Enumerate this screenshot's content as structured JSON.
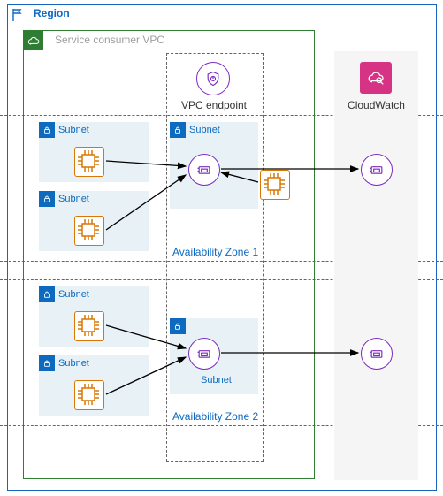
{
  "region": {
    "label": "Region"
  },
  "vpc": {
    "label": "Service consumer VPC"
  },
  "endpoint": {
    "label": "VPC endpoint"
  },
  "cloudwatch": {
    "label": "CloudWatch"
  },
  "az": {
    "zone1": "Availability Zone 1",
    "zone2": "Availability Zone 2"
  },
  "subnets": {
    "s1": "Subnet",
    "s2": "Subnet",
    "s3": "Subnet",
    "s4": "Subnet",
    "s5": "Subnet",
    "s6": "Subnet"
  }
}
